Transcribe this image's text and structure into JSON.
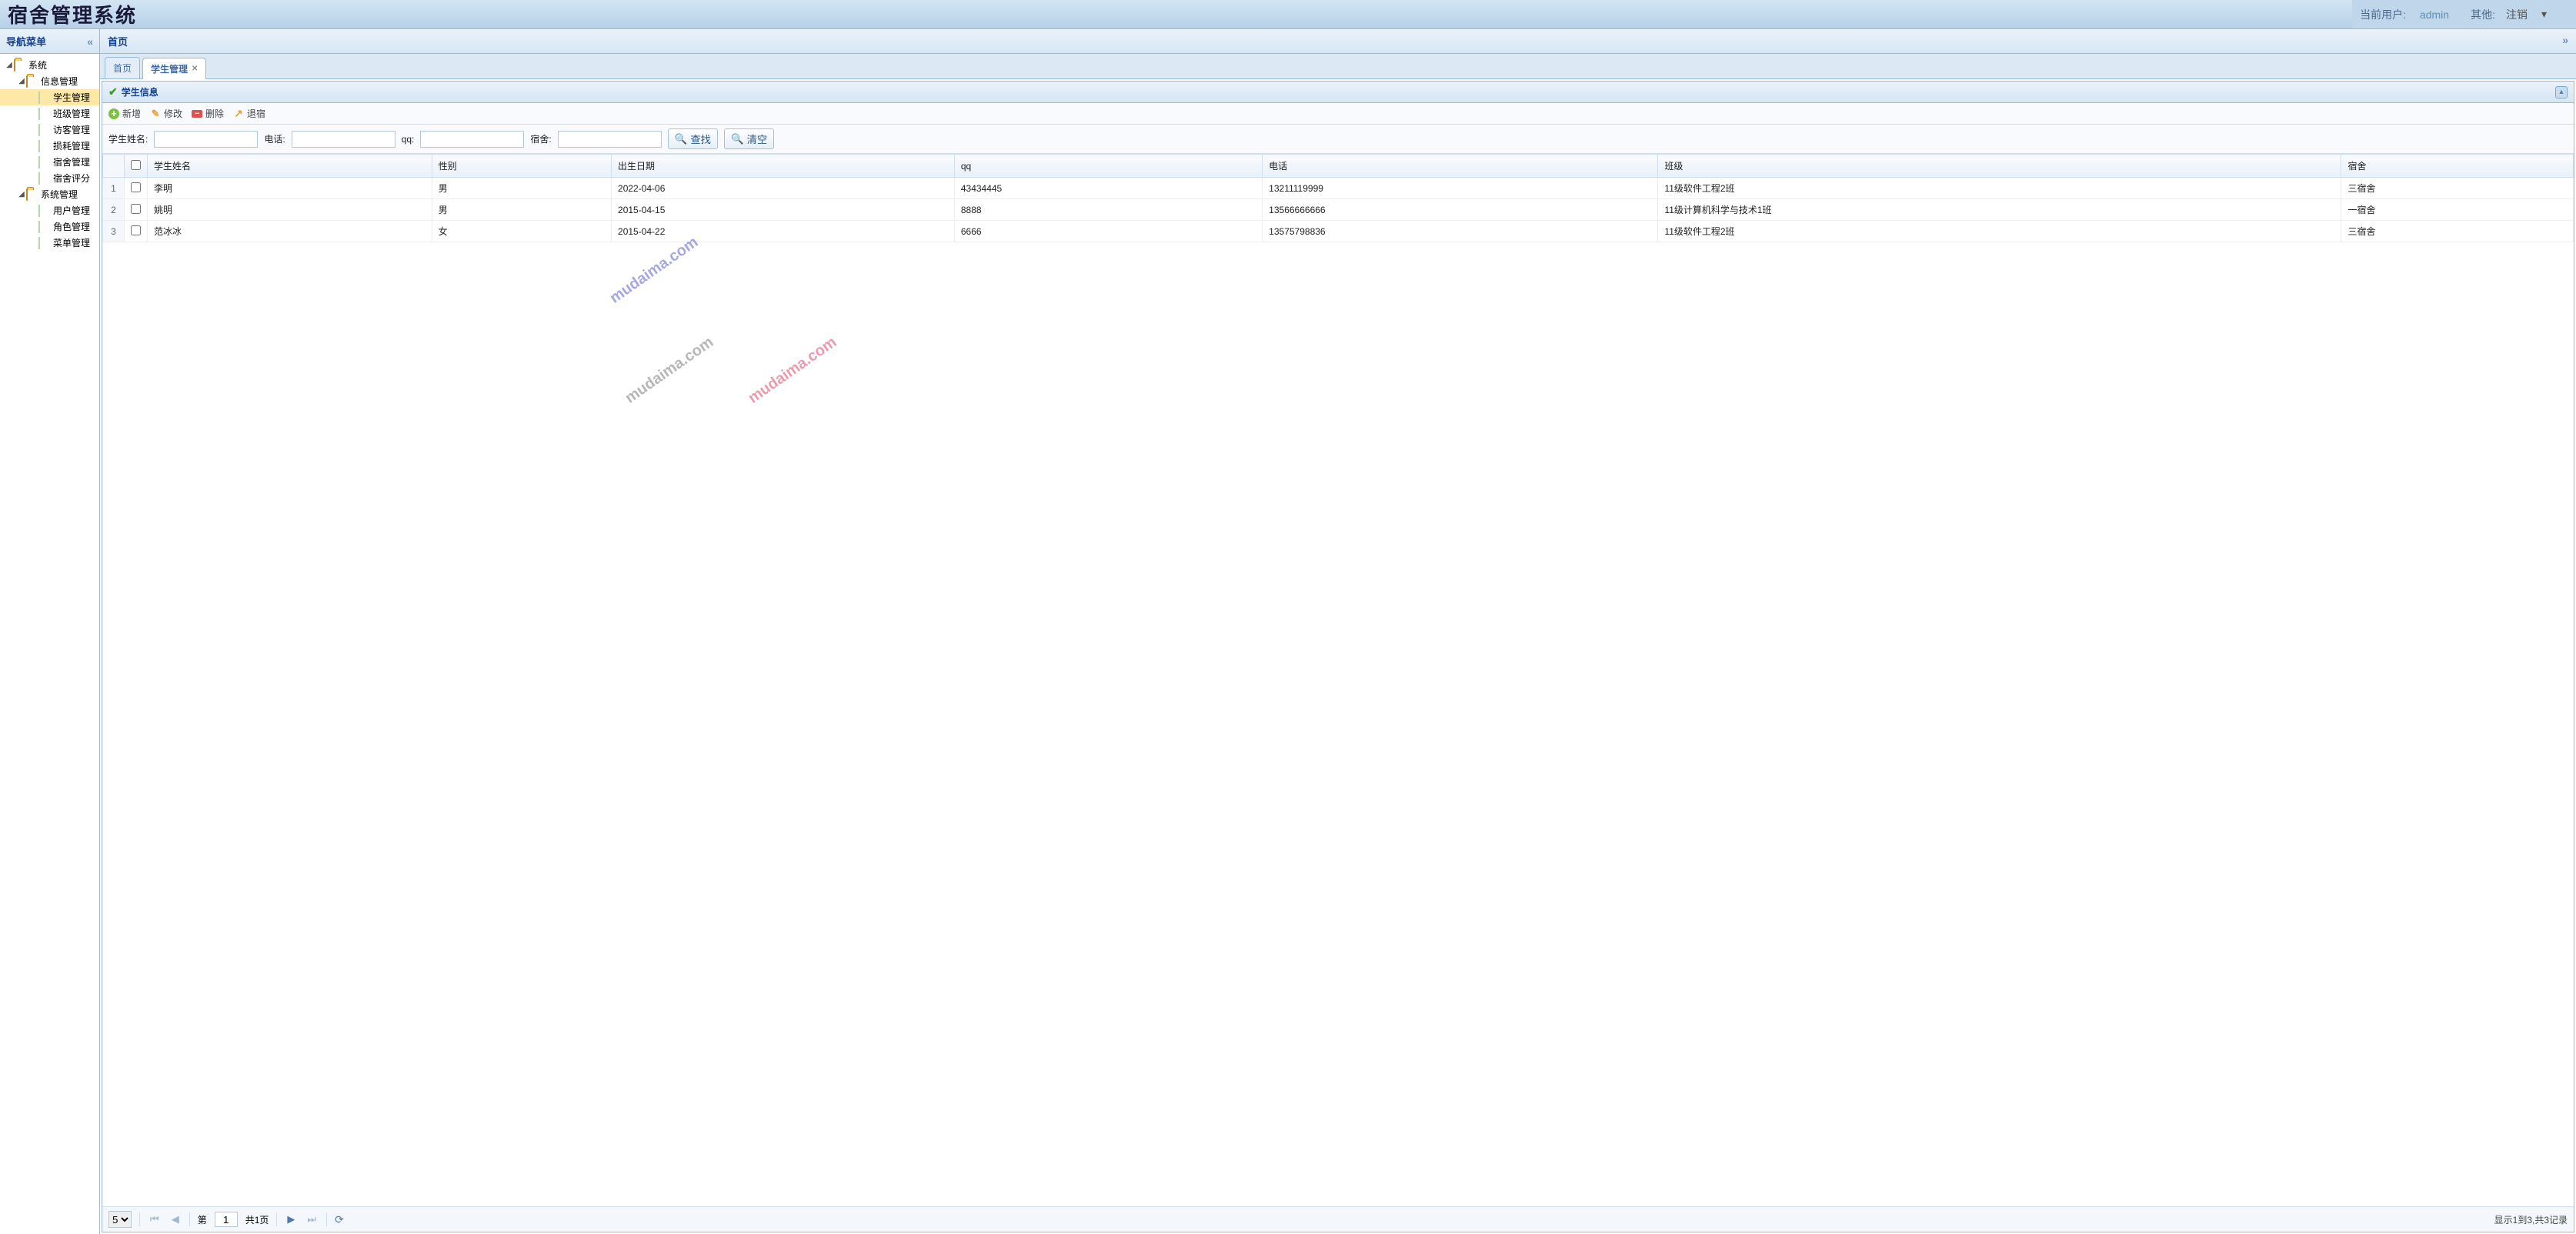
{
  "app": {
    "title": "宿舍管理系统"
  },
  "header": {
    "current_user_label": "当前用户:",
    "current_user": "admin",
    "other_label": "其他:",
    "logout": "注销"
  },
  "sidebar": {
    "title": "导航菜单",
    "tree": [
      {
        "label": "系统",
        "icon": "folder",
        "expanded": true,
        "depth": 0,
        "children": [
          {
            "label": "信息管理",
            "icon": "folder",
            "expanded": true,
            "depth": 1,
            "children": [
              {
                "label": "学生管理",
                "icon": "file",
                "depth": 2,
                "selected": true
              },
              {
                "label": "班级管理",
                "icon": "file",
                "depth": 2
              },
              {
                "label": "访客管理",
                "icon": "file",
                "depth": 2
              },
              {
                "label": "损耗管理",
                "icon": "file",
                "depth": 2
              },
              {
                "label": "宿舍管理",
                "icon": "file",
                "depth": 2
              },
              {
                "label": "宿舍评分",
                "icon": "file",
                "depth": 2
              }
            ]
          },
          {
            "label": "系统管理",
            "icon": "folder",
            "expanded": true,
            "depth": 1,
            "children": [
              {
                "label": "用户管理",
                "icon": "file",
                "depth": 2
              },
              {
                "label": "角色管理",
                "icon": "file",
                "depth": 2
              },
              {
                "label": "菜单管理",
                "icon": "file",
                "depth": 2
              }
            ]
          }
        ]
      }
    ]
  },
  "breadcrumb": "首页",
  "tabs": [
    {
      "label": "首页",
      "closable": false,
      "active": false
    },
    {
      "label": "学生管理",
      "closable": true,
      "active": true
    }
  ],
  "panel": {
    "title": "学生信息"
  },
  "toolbar": {
    "add": "新增",
    "edit": "修改",
    "delete": "删除",
    "checkout": "退宿"
  },
  "search": {
    "name_label": "学生姓名:",
    "phone_label": "电话:",
    "qq_label": "qq:",
    "dorm_label": "宿舍:",
    "find": "查找",
    "clear": "清空"
  },
  "grid": {
    "columns": [
      "学生姓名",
      "性别",
      "出生日期",
      "qq",
      "电话",
      "班级",
      "宿舍"
    ],
    "rows": [
      {
        "n": "1",
        "name": "李明",
        "sex": "男",
        "dob": "2022-04-06",
        "qq": "43434445",
        "phone": "13211119999",
        "class": "11级软件工程2班",
        "dorm": "三宿舍"
      },
      {
        "n": "2",
        "name": "姚明",
        "sex": "男",
        "dob": "2015-04-15",
        "qq": "8888",
        "phone": "13566666666",
        "class": "11级计算机科学与技术1班",
        "dorm": "一宿舍"
      },
      {
        "n": "3",
        "name": "范冰冰",
        "sex": "女",
        "dob": "2015-04-22",
        "qq": "6666",
        "phone": "13575798836",
        "class": "11级软件工程2班",
        "dorm": "三宿舍"
      }
    ]
  },
  "watermark": "mudaima.com",
  "pager": {
    "page_size": "5",
    "page_label_pre": "第",
    "page_current": "1",
    "total_pages": "共1页",
    "info": "显示1到3,共3记录"
  }
}
